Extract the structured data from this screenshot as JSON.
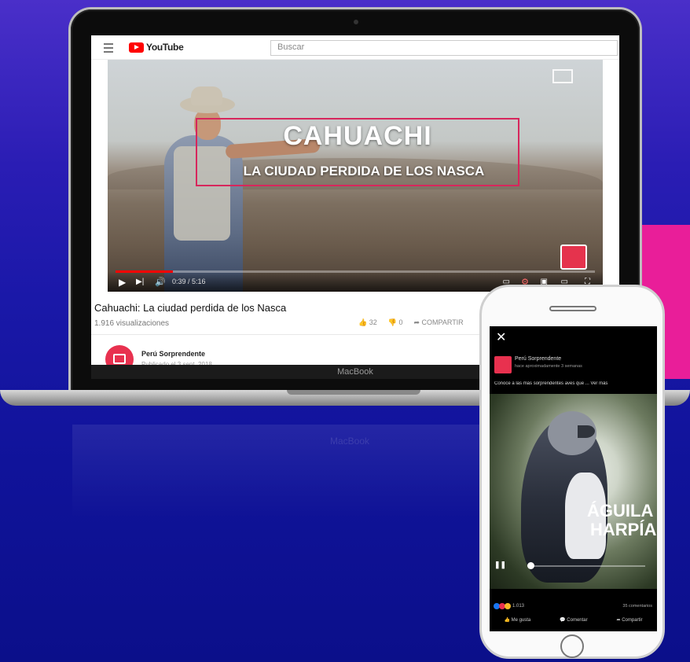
{
  "laptop": {
    "brand_label": "MacBook"
  },
  "youtube": {
    "logo_text": "YouTube",
    "search_placeholder": "Buscar",
    "video": {
      "overlay_title": "CAHUACHI",
      "overlay_subtitle": "LA CIUDAD PERDIDA DE LOS NASCA",
      "time_display": "0:39 / 5:16",
      "progress_fraction": 0.12
    },
    "title": "Cahuachi: La ciudad perdida de los Nasca",
    "views": "1.916 visualizaciones",
    "like_count": "32",
    "dislike_count": "0",
    "share_label": "COMPARTIR",
    "channel_name": "Perú Sorprendente",
    "published": "Publicado el 3 sept. 2018"
  },
  "facebook": {
    "page_name": "Perú Sorprendente",
    "post_time": "hace aproximadamente 3 semanas",
    "caption": "Conoce a las más sorprendentes aves que ... Ver más",
    "overlay_line1": "ÁGUILA",
    "overlay_line2": "HARPÍA",
    "reaction_count": "1.013",
    "comments_label": "35 comentarios",
    "actions": [
      "Me gusta",
      "Comentar",
      "Compartir"
    ]
  },
  "colors": {
    "accent_pink": "#e91e99",
    "youtube_red": "#ff0000",
    "brand_red": "#e8314f"
  }
}
